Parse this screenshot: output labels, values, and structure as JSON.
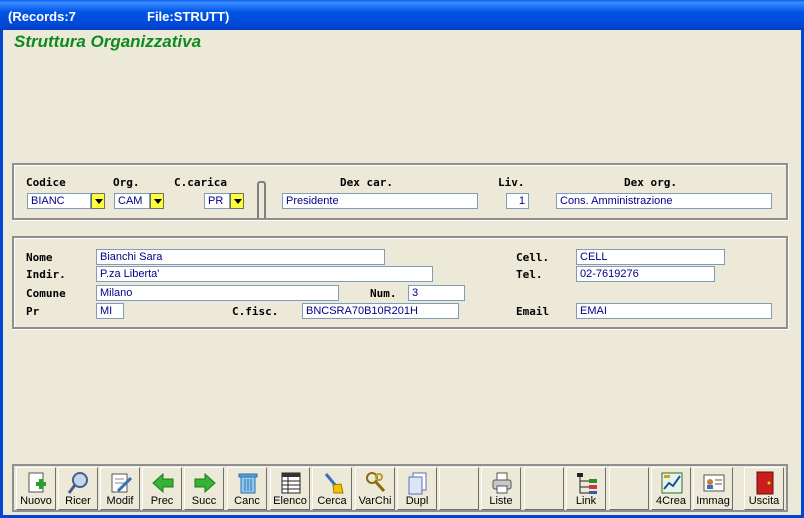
{
  "window": {
    "records": "(Records:7",
    "file": "File:STRUTT)"
  },
  "form_title": "Struttura Organizzativa",
  "top_panel": {
    "codice_label": "Codice",
    "codice_value": "BIANC",
    "org_label": "Org.",
    "org_value": "CAM",
    "ccarica_label": "C.carica",
    "ccarica_value": "PR",
    "dexcar_label": "Dex car.",
    "dexcar_value": "Presidente",
    "liv_label": "Liv.",
    "liv_value": "1",
    "dexorg_label": "Dex org.",
    "dexorg_value": "Cons. Amministrazione"
  },
  "person": {
    "nome_label": "Nome",
    "nome_value": "Bianchi Sara",
    "indir_label": "Indir.",
    "indir_value": "P.za Liberta'",
    "comune_label": "Comune",
    "comune_value": "Milano",
    "num_label": "Num.",
    "num_value": "3",
    "pr_label": "Pr",
    "pr_value": "MI",
    "cfisc_label": "C.fisc.",
    "cfisc_value": "BNCSRA70B10R201H",
    "cell_label": "Cell.",
    "cell_value": "CELL",
    "tel_label": "Tel.",
    "tel_value": "02-7619276",
    "email_label": "Email",
    "email_value": "EMAI"
  },
  "toolbar": [
    {
      "label": "Nuovo",
      "icon": "new-record-icon"
    },
    {
      "label": "Ricer",
      "icon": "search-magnifier-icon"
    },
    {
      "label": "Modif",
      "icon": "edit-document-icon"
    },
    {
      "label": "Prec",
      "icon": "arrow-left-icon"
    },
    {
      "label": "Succ",
      "icon": "arrow-right-icon"
    },
    {
      "label": "Canc",
      "icon": "trash-can-icon"
    },
    {
      "label": "Elenco",
      "icon": "list-table-icon"
    },
    {
      "label": "Cerca",
      "icon": "find-broom-icon"
    },
    {
      "label": "VarChi",
      "icon": "keys-icon"
    },
    {
      "label": "Dupl",
      "icon": "duplicate-pages-icon"
    },
    {
      "label": "",
      "icon": ""
    },
    {
      "label": "Liste",
      "icon": "printer-icon"
    },
    {
      "label": "",
      "icon": ""
    },
    {
      "label": "Link",
      "icon": "tree-link-icon"
    },
    {
      "label": "",
      "icon": ""
    },
    {
      "label": "4Crea",
      "icon": "create-chart-icon"
    },
    {
      "label": "Immag",
      "icon": "id-card-icon"
    },
    {
      "label": "Uscita",
      "icon": "exit-door-icon"
    }
  ],
  "colors": {
    "title_green": "#0E8A1E",
    "field_text": "#00008B",
    "dropdown_yellow": "#FFFF3A"
  }
}
